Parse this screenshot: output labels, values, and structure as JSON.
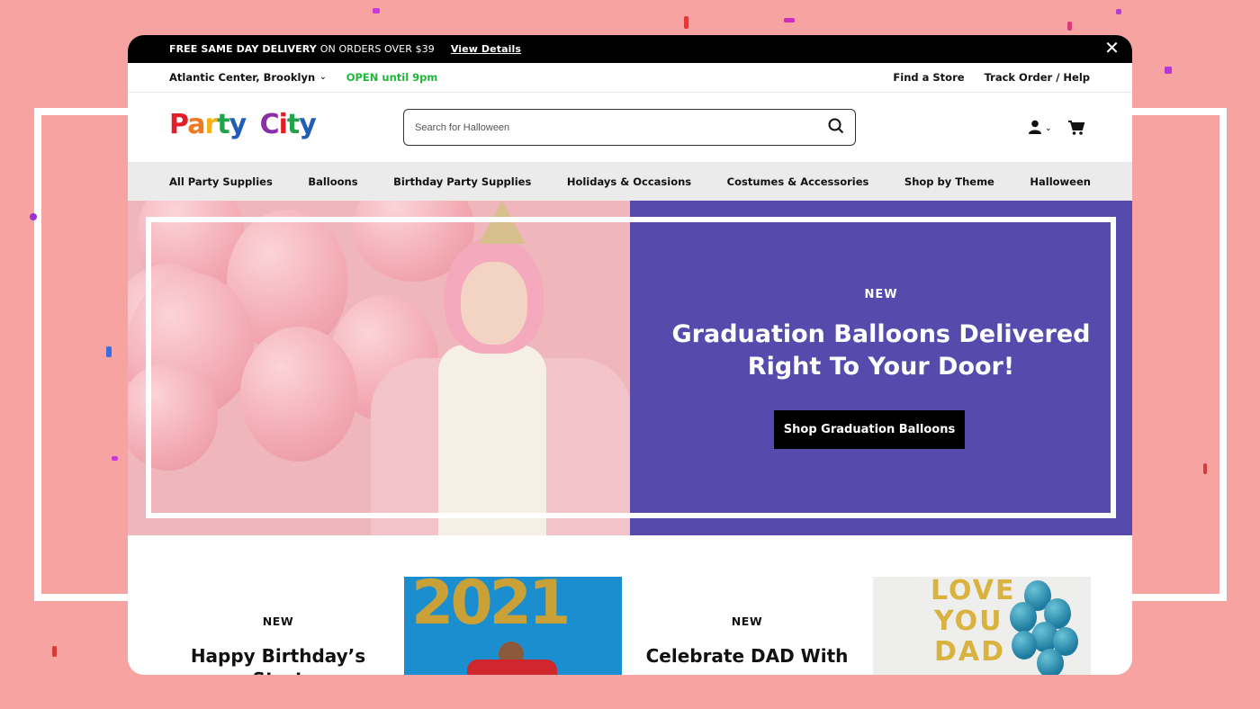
{
  "promo_bar": {
    "bold_text": "FREE SAME DAY DELIVERY",
    "text": "ON ORDERS OVER $39",
    "link": "View Details"
  },
  "store_bar": {
    "location": "Atlantic Center, Brooklyn",
    "status": "OPEN until 9pm",
    "find_store": "Find a Store",
    "track_order": "Track Order / Help"
  },
  "header": {
    "logo": {
      "p": "P",
      "a": "a",
      "r": "r",
      "t": "t",
      "y": "y",
      "c": "C",
      "i": "i",
      "t2": "t",
      "y2": "y"
    },
    "search_placeholder": "Search for Halloween"
  },
  "nav": {
    "items": [
      "All Party Supplies",
      "Balloons",
      "Birthday Party Supplies",
      "Holidays & Occasions",
      "Costumes & Accessories",
      "Shop by Theme",
      "Halloween"
    ]
  },
  "hero": {
    "eyebrow": "NEW",
    "title_line1": "Graduation Balloons Delivered",
    "title_line2": "Right To Your Door!",
    "button": "Shop Graduation Balloons"
  },
  "cards": [
    {
      "eyebrow": "NEW",
      "title": "Happy Birthday’s Start",
      "image_text": "2021"
    },
    {
      "eyebrow": "NEW",
      "title": "Celebrate DAD With",
      "image_text_line1": "LOVE",
      "image_text_line2": "YOU",
      "image_text_line3": "DAD"
    }
  ],
  "colors": {
    "page_bg": "#f7a3a1",
    "hero_purple": "#564aac",
    "open_green": "#1db83a",
    "logo_red": "#e21f26",
    "logo_green": "#22a24a",
    "logo_blue": "#1f5db8"
  }
}
